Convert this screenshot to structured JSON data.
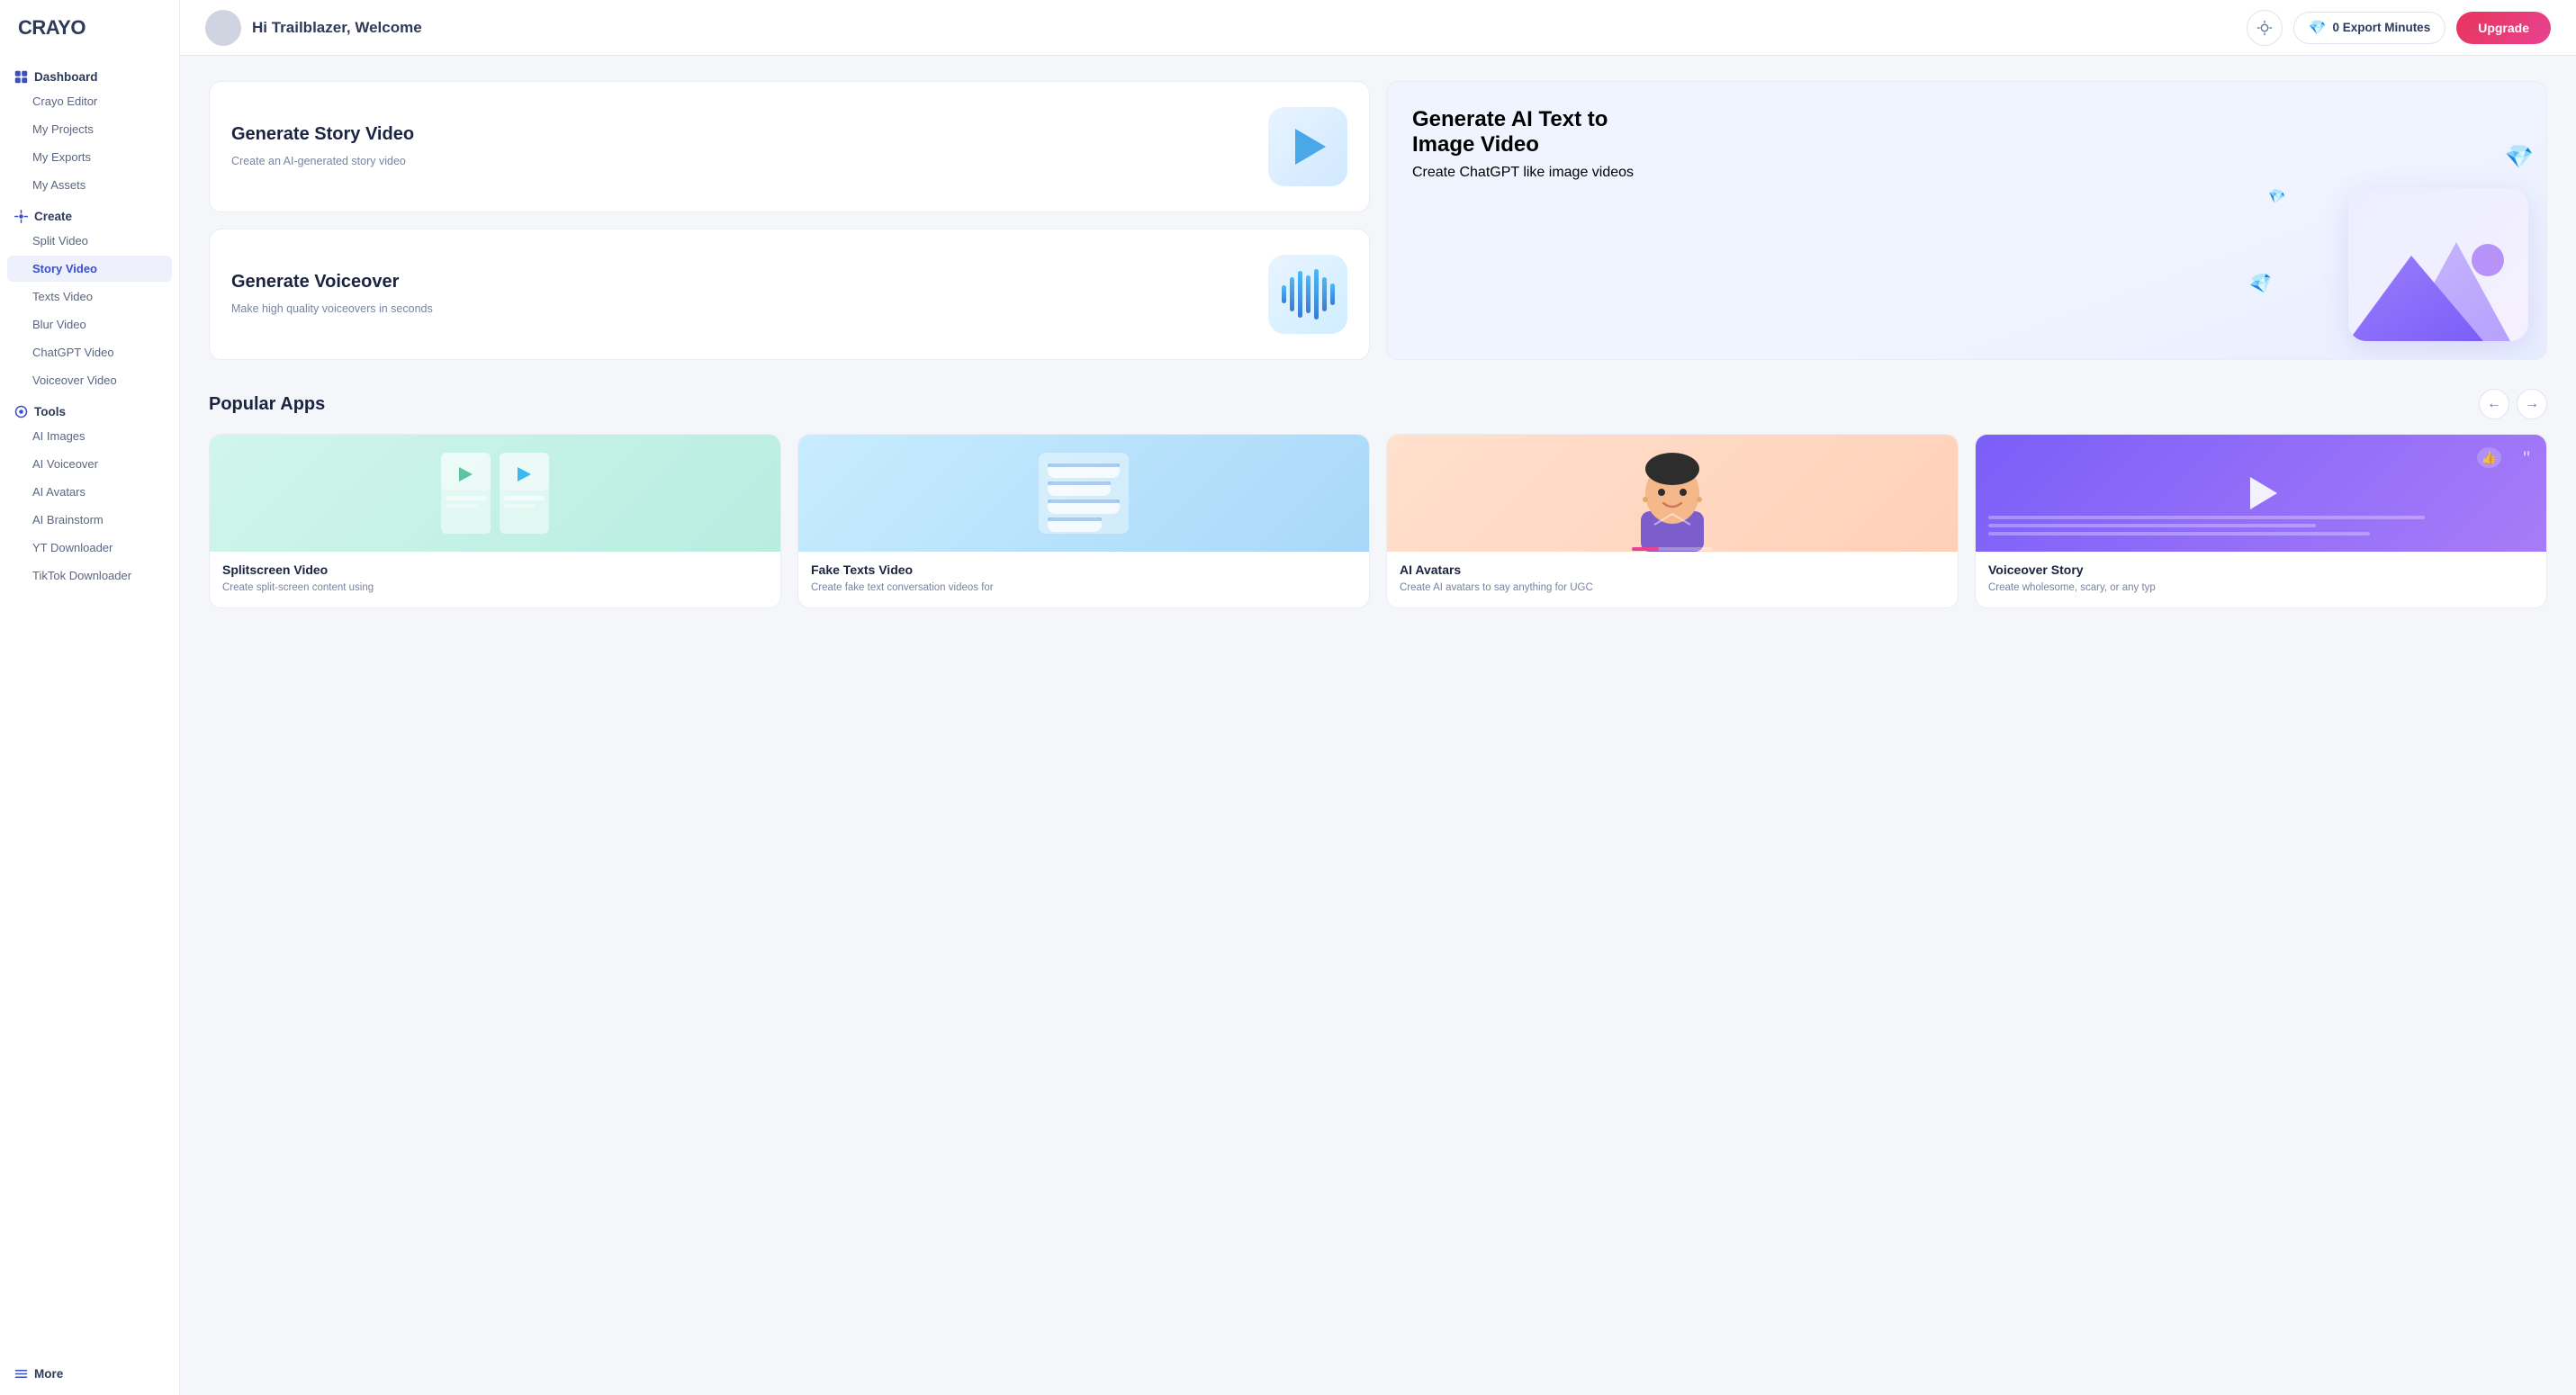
{
  "logo": "CRAYO",
  "topbar": {
    "welcome_text": "Hi Trailblazer, Welcome",
    "export_minutes_label": "0 Export Minutes",
    "upgrade_label": "Upgrade"
  },
  "sidebar": {
    "dashboard_label": "Dashboard",
    "dashboard_items": [
      {
        "id": "crayo-editor",
        "label": "Crayo Editor"
      },
      {
        "id": "my-projects",
        "label": "My Projects"
      },
      {
        "id": "my-exports",
        "label": "My Exports"
      },
      {
        "id": "my-assets",
        "label": "My Assets"
      }
    ],
    "create_label": "Create",
    "create_items": [
      {
        "id": "split-video",
        "label": "Split Video"
      },
      {
        "id": "story-video",
        "label": "Story Video"
      },
      {
        "id": "texts-video",
        "label": "Texts Video"
      },
      {
        "id": "blur-video",
        "label": "Blur Video"
      },
      {
        "id": "chatgpt-video",
        "label": "ChatGPT Video"
      },
      {
        "id": "voiceover-video",
        "label": "Voiceover Video"
      }
    ],
    "tools_label": "Tools",
    "tools_items": [
      {
        "id": "ai-images",
        "label": "AI Images"
      },
      {
        "id": "ai-voiceover",
        "label": "AI Voiceover"
      },
      {
        "id": "ai-avatars",
        "label": "AI Avatars"
      },
      {
        "id": "ai-brainstorm",
        "label": "AI Brainstorm"
      },
      {
        "id": "yt-downloader",
        "label": "YT Downloader"
      },
      {
        "id": "tiktok-downloader",
        "label": "TikTok Downloader"
      }
    ],
    "more_label": "More"
  },
  "hero": {
    "card1_title": "Generate Story Video",
    "card1_desc": "Create an AI-generated story video",
    "card2_title": "Generate AI Text to Image Video",
    "card2_desc": "Create ChatGPT like image videos",
    "card3_title": "Generate Voiceover",
    "card3_desc": "Make high quality voiceovers in seconds"
  },
  "popular_apps": {
    "section_title": "Popular Apps",
    "apps": [
      {
        "id": "splitscreen",
        "title": "Splitscreen Video",
        "desc": "Create split-screen content using"
      },
      {
        "id": "faketexts",
        "title": "Fake Texts Video",
        "desc": "Create fake text conversation videos for"
      },
      {
        "id": "avatars",
        "title": "AI Avatars",
        "desc": "Create AI avatars to say anything for UGC"
      },
      {
        "id": "voiceover-story",
        "title": "Voiceover Story",
        "desc": "Create wholesome, scary, or any typ"
      }
    ]
  }
}
